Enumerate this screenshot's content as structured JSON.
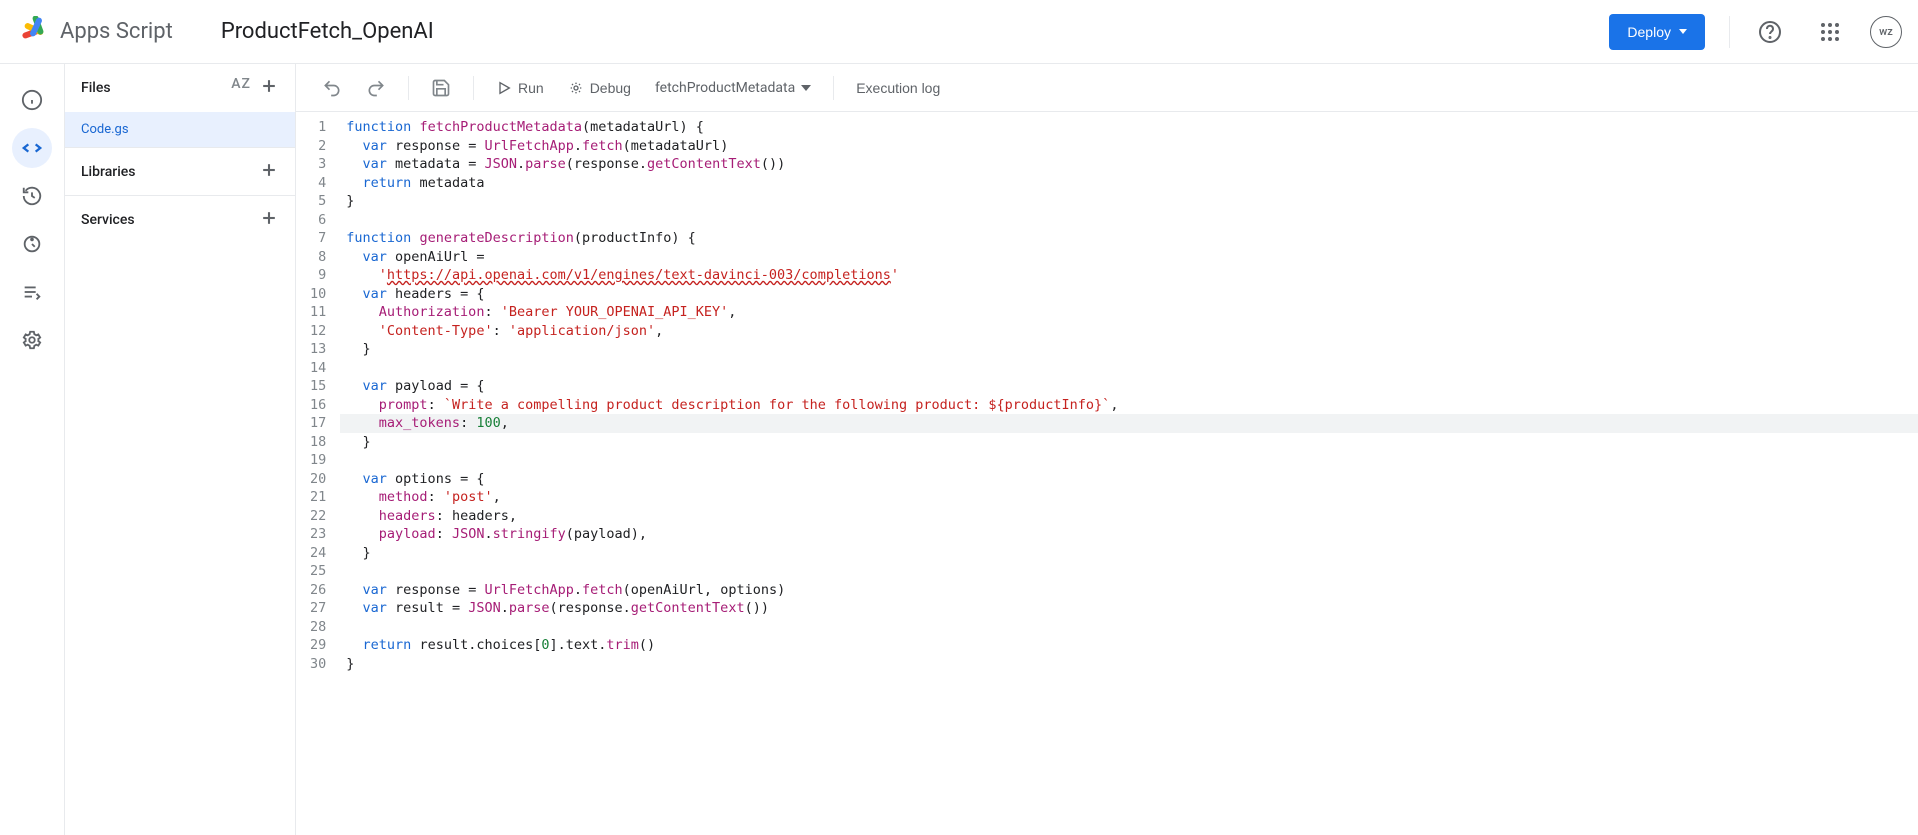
{
  "header": {
    "app_name": "Apps Script",
    "project_name": "ProductFetch_OpenAI",
    "deploy_label": "Deploy",
    "avatar_initials": "wz"
  },
  "sidebar": {
    "files_label": "Files",
    "file_name": "Code.gs",
    "libraries_label": "Libraries",
    "services_label": "Services"
  },
  "toolbar": {
    "run_label": "Run",
    "debug_label": "Debug",
    "selected_function": "fetchProductMetadata",
    "execution_log_label": "Execution log"
  },
  "code": {
    "fn1_name": "fetchProductMetadata",
    "fn1_param": "metadataUrl",
    "fn2_name": "generateDescription",
    "fn2_param": "productInfo",
    "url_fetch_app": "UrlFetchApp",
    "json": "JSON",
    "openai_url": "https://api.openai.com/v1/engines/text-davinci-003/completions",
    "auth_value": "'Bearer YOUR_OPENAI_API_KEY'",
    "content_type_key": "'Content-Type'",
    "content_type_val": "'application/json'",
    "prompt_template": "`Write a compelling product description for the following product: ${productInfo}`",
    "max_tokens": "100",
    "method_val": "'post'",
    "choices_idx": "0"
  }
}
